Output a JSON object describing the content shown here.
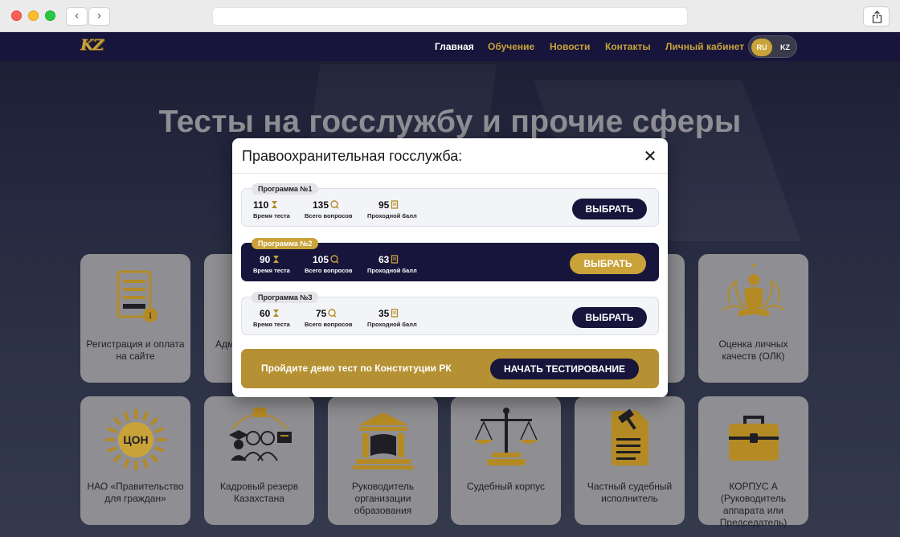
{
  "browser": {
    "back_glyph": "‹",
    "forward_glyph": "›",
    "share_icon": "share-icon"
  },
  "header": {
    "logo_text": "KZ",
    "menu": [
      {
        "label": "Главная",
        "active": true
      },
      {
        "label": "Обучение",
        "active": false
      },
      {
        "label": "Новости",
        "active": false
      },
      {
        "label": "Контакты",
        "active": false
      },
      {
        "label": "Личный кабинет",
        "active": false
      }
    ],
    "lang": {
      "ru": "RU",
      "kz": "KZ",
      "selected": "RU"
    }
  },
  "hero": {
    "title": "Тесты на госслужбу и прочие сферы"
  },
  "cards_row1": [
    {
      "label": "Регистрация и оплата на сайте",
      "icon": "tablet-info-icon"
    },
    {
      "label": "Адм",
      "icon": "admin-icon"
    },
    {
      "label": "",
      "icon": ""
    },
    {
      "label": "",
      "icon": ""
    },
    {
      "label": "",
      "icon": ""
    },
    {
      "label": "Оценка личных качеств (ОЛК)",
      "icon": "lotus-meditation-icon"
    }
  ],
  "cards_row2": [
    {
      "label": "НАО «Правительство для граждан»",
      "icon": "con-sun-icon",
      "icon_text": "ЦОН"
    },
    {
      "label": "Кадровый резерв Казахстана",
      "icon": "people-reserve-icon"
    },
    {
      "label": "Руководитель организации образования",
      "icon": "building-book-icon"
    },
    {
      "label": "Судебный корпус",
      "icon": "scales-icon"
    },
    {
      "label": "Частный судебный исполнитель",
      "icon": "gavel-document-icon"
    },
    {
      "label": "КОРПУС А (Руководитель аппарата или Председатель)",
      "icon": "briefcase-icon"
    }
  ],
  "modal": {
    "title": "Правоохранительная госслужба:",
    "close_glyph": "✕",
    "programs": [
      {
        "tag": "Программа №1",
        "time": "110",
        "time_label": "Время теста",
        "questions": "135",
        "questions_label": "Всего вопросов",
        "pass": "95",
        "pass_label": "Проходной балл",
        "button": "ВЫБРАТЬ",
        "highlighted": false
      },
      {
        "tag": "Программа №2",
        "time": "90",
        "time_label": "Время теста",
        "questions": "105",
        "questions_label": "Всего вопросов",
        "pass": "63",
        "pass_label": "Проходной балл",
        "button": "ВЫБРАТЬ",
        "highlighted": true
      },
      {
        "tag": "Программа №3",
        "time": "60",
        "time_label": "Время теста",
        "questions": "75",
        "questions_label": "Всего вопросов",
        "pass": "35",
        "pass_label": "Проходной балл",
        "button": "ВЫБРАТЬ",
        "highlighted": false
      }
    ],
    "demo": {
      "text": "Пройдите демо тест по Конституции РК",
      "button": "НАЧАТЬ ТЕСТИРОВАНИЕ"
    }
  },
  "colors": {
    "navy": "#17153b",
    "gold": "#c9a33a",
    "gold_dark": "#b59133"
  }
}
